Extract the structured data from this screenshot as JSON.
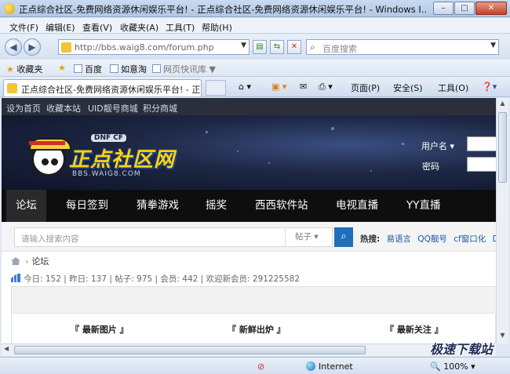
{
  "window": {
    "title": "正点综合社区-免费网络资源休闲娱乐平台! - 正点综合社区-免费网络资源休闲娱乐平台! - Windows I...",
    "min_label": "–",
    "max_label": "□",
    "close_label": "✕"
  },
  "menu": [
    "文件(F)",
    "编辑(E)",
    "查看(V)",
    "收藏夹(A)",
    "工具(T)",
    "帮助(H)"
  ],
  "address": {
    "url": "http://bbs.waig8.com/forum.php",
    "search_placeholder": "百度搜索"
  },
  "favorites": {
    "label": "收藏夹",
    "items": [
      "百度",
      "如意淘",
      "网页快讯库"
    ]
  },
  "tab": {
    "title": "正点综合社区-免费网络资源休闲娱乐平台! - 正..."
  },
  "commands": [
    "页面(P)",
    "安全(S)",
    "工具(O)"
  ],
  "site": {
    "top_links": [
      "设为首页",
      "收藏本站",
      "UID靓号商城",
      "积分商城"
    ],
    "logo_text": "正点社区网",
    "logo_badge": "DNF CF",
    "logo_sub": "BBS.WAIG8.COM",
    "login": {
      "username_label": "用户名",
      "password_label": "密码"
    },
    "nav": [
      "论坛",
      "每日签到",
      "猜拳游戏",
      "摇奖",
      "西西软件站",
      "电视直播",
      "YY直播"
    ],
    "search": {
      "placeholder": "请输入搜索内容",
      "type": "帖子",
      "hot_label": "热搜:",
      "hot_words": [
        "易语言",
        "QQ靓号",
        "cf窗口化",
        "DN"
      ]
    },
    "breadcrumb": "论坛",
    "stats": "今日: 152 | 昨日: 137 | 帖子: 975 | 会员: 442 | 欢迎新会员: 291225582",
    "panels": [
      "『 最新图片 』",
      "『 新鲜出炉 』",
      "『 最新关注 』"
    ]
  },
  "status": {
    "zone": "Internet",
    "zoom": "100%"
  },
  "watermark": "极速下载站"
}
